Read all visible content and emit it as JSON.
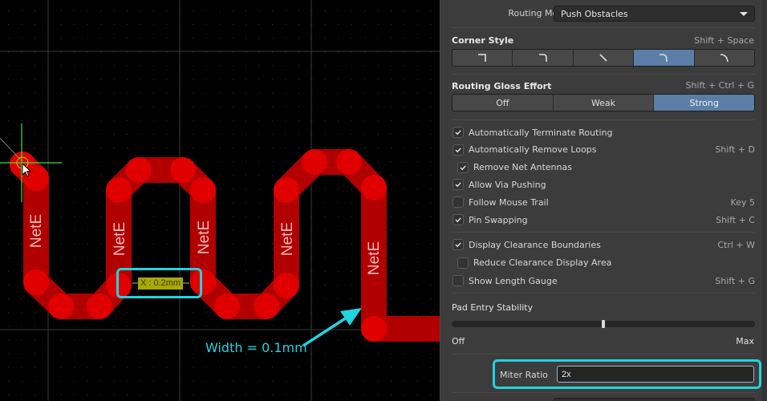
{
  "canvas": {
    "net_labels": [
      "NetE",
      "NetE",
      "NetE",
      "NetE",
      "NetE"
    ],
    "gap_measure_label": "X : 0.2mm",
    "width_annotation": "Width = 0.1mm",
    "colors": {
      "trace": "#b00000",
      "trace_vertex": "#e00000",
      "net_label": "#f5b8b8",
      "annotation": "#22d3df",
      "measure_bg": "#a8a800",
      "cursor_cross": "#3fdc3f",
      "grid_major": "#3a3a3a",
      "grid_dot": "#2e2e2e"
    }
  },
  "panel": {
    "routing_mode": {
      "label": "Routing Mode",
      "value": "Push Obstacles"
    },
    "corner_style": {
      "title": "Corner Style",
      "shortcut": "Shift + Space",
      "options": [
        "90 Degrees",
        "90 Degrees With Arc",
        "45 Degrees",
        "45 Degrees With Arc",
        "Any Angle With Arc"
      ],
      "selected_index": 3
    },
    "gloss_effort": {
      "title": "Routing Gloss Effort",
      "shortcut": "Shift + Ctrl + G",
      "options": [
        "Off",
        "Weak",
        "Strong"
      ],
      "selected_index": 2
    },
    "options_group1": [
      {
        "label": "Automatically Terminate Routing",
        "checked": true,
        "shortcut": "",
        "indent": false
      },
      {
        "label": "Automatically Remove Loops",
        "checked": true,
        "shortcut": "Shift + D",
        "indent": false
      },
      {
        "label": "Remove Net Antennas",
        "checked": true,
        "shortcut": "",
        "indent": true
      },
      {
        "label": "Allow Via Pushing",
        "checked": true,
        "shortcut": "",
        "indent": false
      },
      {
        "label": "Follow Mouse Trail",
        "checked": false,
        "shortcut": "Key 5",
        "indent": false
      },
      {
        "label": "Pin Swapping",
        "checked": true,
        "shortcut": "Shift + C",
        "indent": false
      }
    ],
    "options_group2": [
      {
        "label": "Display Clearance Boundaries",
        "checked": true,
        "shortcut": "Ctrl + W",
        "indent": false
      },
      {
        "label": "Reduce Clearance Display Area",
        "checked": false,
        "shortcut": "",
        "indent": true
      },
      {
        "label": "Show Length Gauge",
        "checked": false,
        "shortcut": "Shift + G",
        "indent": false
      }
    ],
    "pad_entry_stability": {
      "title": "Pad Entry Stability",
      "min_label": "Off",
      "max_label": "Max",
      "value_fraction": 0.5
    },
    "miter_ratio": {
      "label": "Miter Ratio",
      "value": "2x"
    }
  }
}
